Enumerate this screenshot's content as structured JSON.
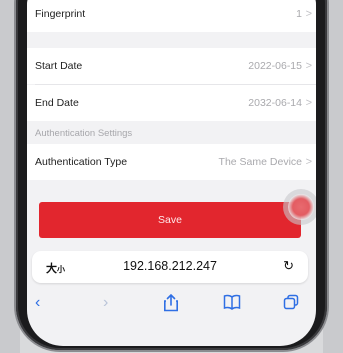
{
  "settings": {
    "fingerprint": {
      "label": "Fingerprint",
      "value": "1"
    },
    "start_date": {
      "label": "Start Date",
      "value": "2022-06-15"
    },
    "end_date": {
      "label": "End Date",
      "value": "2032-06-14"
    },
    "auth_section": "Authentication Settings",
    "auth_type": {
      "label": "Authentication Type",
      "value": "The Same Device"
    },
    "chevron": ">"
  },
  "save_label": "Save",
  "browser": {
    "text_size_label": "大",
    "text_size_small": "小",
    "url": "192.168.212.247",
    "icons": [
      "back-icon",
      "forward-icon",
      "share-icon",
      "bookmarks-icon",
      "tabs-icon",
      "reload-icon"
    ]
  },
  "colors": {
    "accent": "#e2262e",
    "link": "#2f6fe4"
  }
}
